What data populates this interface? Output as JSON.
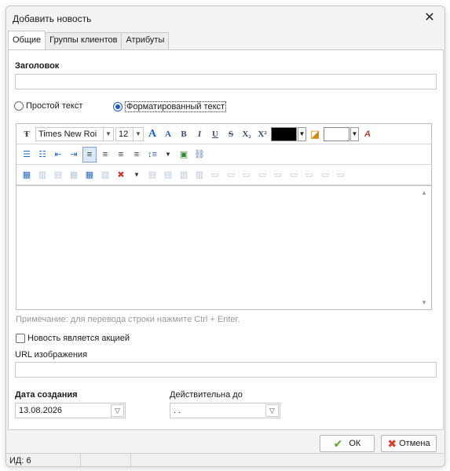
{
  "window": {
    "title": "Добавить новость"
  },
  "tabs": [
    {
      "label": "Общие",
      "active": true
    },
    {
      "label": "Группы клиентов",
      "active": false
    },
    {
      "label": "Атрибуты",
      "active": false
    }
  ],
  "form": {
    "title_label": "Заголовок",
    "title_value": "",
    "radio_plain": "Простой текст",
    "radio_formatted": "Форматированный текст",
    "selected_mode": "formatted",
    "note": "Примечание: для перевода строки нажмите Ctrl + Enter.",
    "promo_label": "Новость является акцией",
    "promo_checked": false,
    "image_url_label": "URL изображения",
    "image_url_value": "",
    "created_label": "Дата создания",
    "created_value": "13.08.2026",
    "valid_until_label": "Действительна до",
    "valid_until_value": ". ."
  },
  "toolbar": {
    "font_name": "Times New Roi",
    "font_size": "12",
    "grow_font": "A",
    "shrink_font": "A",
    "bold": "B",
    "italic": "I",
    "underline": "U",
    "strike": "S",
    "subscript": "X₂",
    "superscript": "X²",
    "text_color": "#000000",
    "highlight_color": "#ffffff"
  },
  "buttons": {
    "ok": "ОК",
    "cancel": "Отмена"
  },
  "status": {
    "id_text": "ИД: 6"
  },
  "icons": {
    "close": "close-icon",
    "ok": "checkmark-icon",
    "cancel": "cross-icon"
  }
}
